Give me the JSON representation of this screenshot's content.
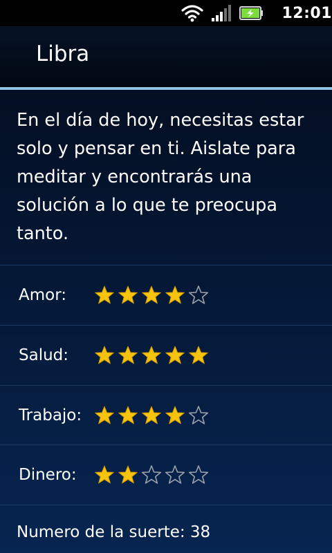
{
  "status_bar": {
    "time": "12:01",
    "icons": [
      "wifi-icon",
      "signal-icon",
      "battery-charging-icon"
    ],
    "battery_color": "#7ddc3c"
  },
  "header": {
    "title": "Libra",
    "accent_color": "#8ec3e6"
  },
  "horoscope": {
    "text": "En el día de hoy, necesitas estar solo y pensar en ti. Aislate para meditar y encontrarás una solución a lo que te preocupa tanto."
  },
  "ratings": [
    {
      "label": "Amor:",
      "stars": 4,
      "max": 5
    },
    {
      "label": "Salud:",
      "stars": 5,
      "max": 5
    },
    {
      "label": "Trabajo:",
      "stars": 4,
      "max": 5
    },
    {
      "label": "Dinero:",
      "stars": 2,
      "max": 5
    }
  ],
  "star_colors": {
    "filled": "#f6c40e",
    "outline": "#9aa3ad"
  },
  "lucky_number": {
    "text": "Numero de la suerte: 38"
  }
}
